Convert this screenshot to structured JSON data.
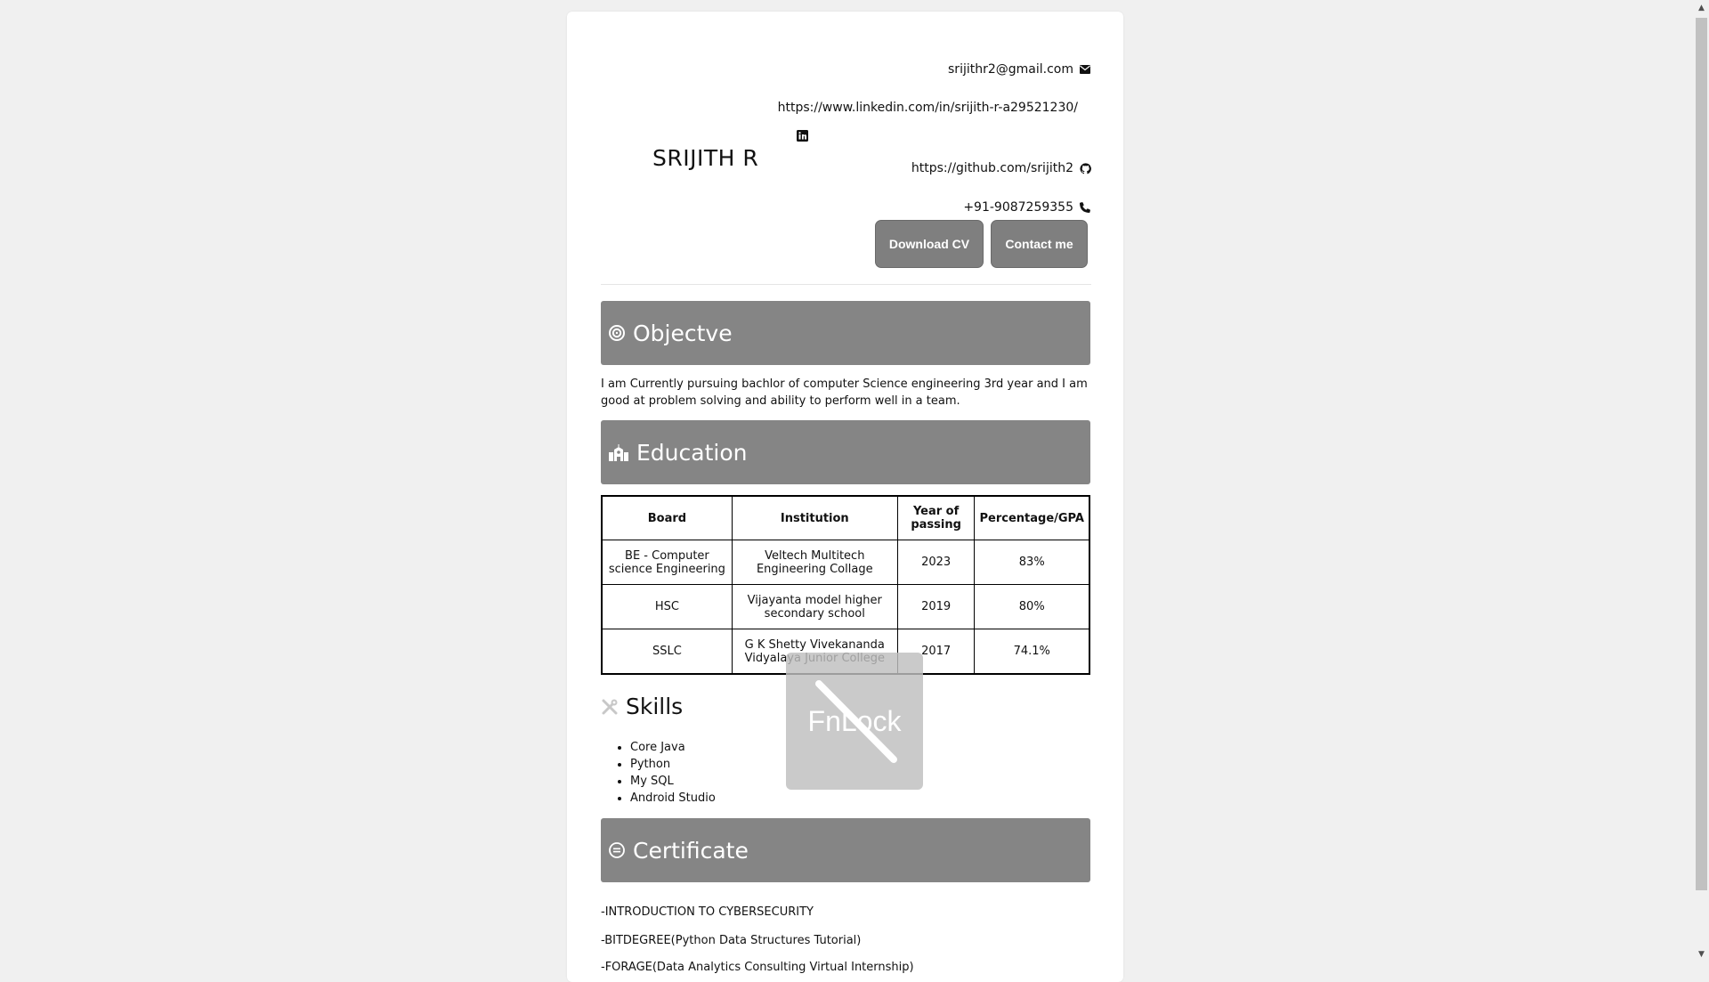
{
  "contact": {
    "email": "srijithr2@gmail.com",
    "linkedin": "https://www.linkedin.com/in/srijith-r-a29521230/",
    "github": "https://github.com/srijith2",
    "phone": "+91-9087259355"
  },
  "name": "SRIJITH R",
  "buttons": {
    "download": "Download CV",
    "contact": "Contact me"
  },
  "objective": {
    "heading": "Objectve",
    "text": "I am Currently pursuing bachlor of computer Science engineering 3rd year and I am good at problem solving and ability to perform well in a team."
  },
  "education": {
    "heading": "Education",
    "columns": [
      "Board",
      "Institution",
      "Year of passing",
      "Percentage/GPA"
    ],
    "rows": [
      [
        "BE - Computer science Engineering",
        "Veltech Multitech Engineering Collage",
        "2023",
        "83%"
      ],
      [
        "HSC",
        "Vijayanta model higher secondary school",
        "2019",
        "80%"
      ],
      [
        "SSLC",
        "G K Shetty Vivekananda Vidyalaya Junior College",
        "2017",
        "74.1%"
      ]
    ]
  },
  "skills": {
    "heading": "Skills",
    "items": [
      "Core Java",
      "Python",
      "My SQL",
      "Android Studio"
    ]
  },
  "certificate": {
    "heading": "Certificate",
    "items": [
      "-INTRODUCTION TO CYBERSECURITY",
      "-BITDEGREE(Python Data Structures Tutorial)",
      "-FORAGE(Data Analytics Consulting Virtual Internship)"
    ]
  },
  "overlay": {
    "text": "FnLock"
  },
  "colors": {
    "section_bg": "#858585",
    "button_bg": "#7f7f7f",
    "page_bg": "#f0f0f0"
  }
}
